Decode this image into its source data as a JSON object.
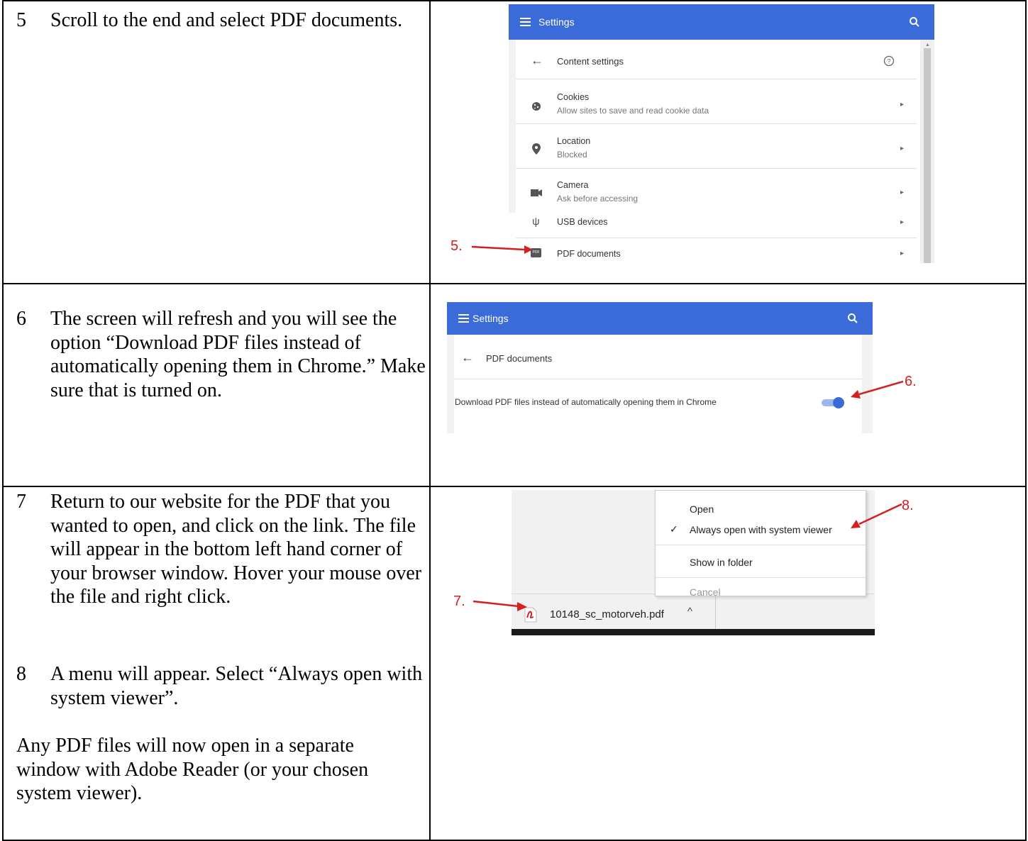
{
  "steps": {
    "s5": {
      "num": "5",
      "text": "Scroll to the end and select PDF documents."
    },
    "s6": {
      "num": "6",
      "text": "The screen will refresh and you will see the option “Download PDF files instead of automatically opening them in Chrome.” Make sure that is turned on."
    },
    "s7": {
      "num": "7",
      "text": "Return to our website for the PDF that you wanted to open, and click on the link. The file will appear in the bottom left hand corner of your browser window. Hover your mouse over the file and right click."
    },
    "s8": {
      "num": "8",
      "text": "A menu will appear. Select “Always open with system viewer”."
    },
    "note": "Any PDF files will now open in a separate window with Adobe Reader (or your chosen system viewer)."
  },
  "shot1": {
    "bar_title": "Settings",
    "page_title": "Content settings",
    "rows": [
      {
        "label": "Cookies",
        "sub": "Allow sites to save and read cookie data",
        "icon": "cookie-icon"
      },
      {
        "label": "Location",
        "sub": "Blocked",
        "icon": "location-pin-icon"
      },
      {
        "label": "Camera",
        "sub": "Ask before accessing",
        "icon": "camera-icon"
      },
      {
        "label": "USB devices",
        "sub": "",
        "icon": "usb-icon"
      },
      {
        "label": "PDF documents",
        "sub": "",
        "icon": "pdf-icon"
      }
    ],
    "callout": "5."
  },
  "shot2": {
    "bar_title": "Settings",
    "page_title": "PDF documents",
    "option": "Download PDF files instead of automatically opening them in Chrome",
    "toggle_on": true,
    "callout": "6."
  },
  "shot3": {
    "menu": [
      "Open",
      "Always open with system viewer",
      "Show in folder",
      "Cancel"
    ],
    "checked_item": "Always open with system viewer",
    "file_name": "10148_sc_motorveh.pdf",
    "callout_file": "7.",
    "callout_menu": "8."
  },
  "colors": {
    "accent_blue": "#3b6bd8",
    "annotation_red": "#d42020"
  }
}
